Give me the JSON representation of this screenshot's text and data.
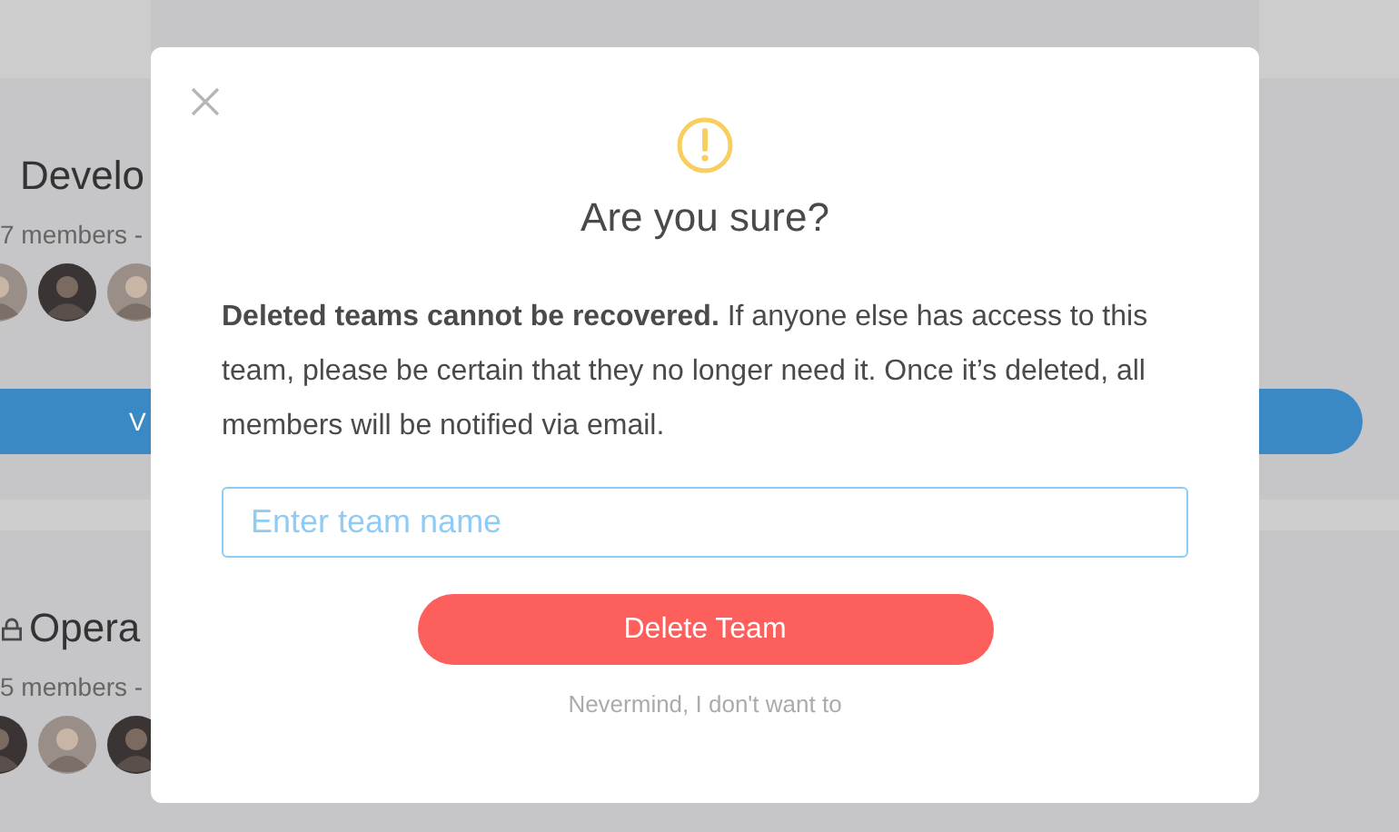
{
  "background_cards": [
    {
      "title": "Develo",
      "locked": false,
      "members": "7 members -",
      "avatars": [
        {
          "kind": "light"
        },
        {
          "kind": "dark"
        },
        {
          "kind": "light"
        }
      ],
      "button": "V"
    },
    {
      "title": "Opera",
      "locked": true,
      "members": "5 members -",
      "avatars": [
        {
          "kind": "dark"
        },
        {
          "kind": "light"
        },
        {
          "kind": "dark"
        }
      ]
    }
  ],
  "dialog": {
    "title": "Are you sure?",
    "message": "**Deleted teams cannot be recovered.** If anyone else has access to this team, please be certain that they no longer need it. Once it’s deleted, all members will be notified via email.",
    "input": {
      "placeholder": "Enter team name"
    },
    "confirm_button": "Delete Team",
    "cancel_link": "Nevermind, I don't want to"
  }
}
